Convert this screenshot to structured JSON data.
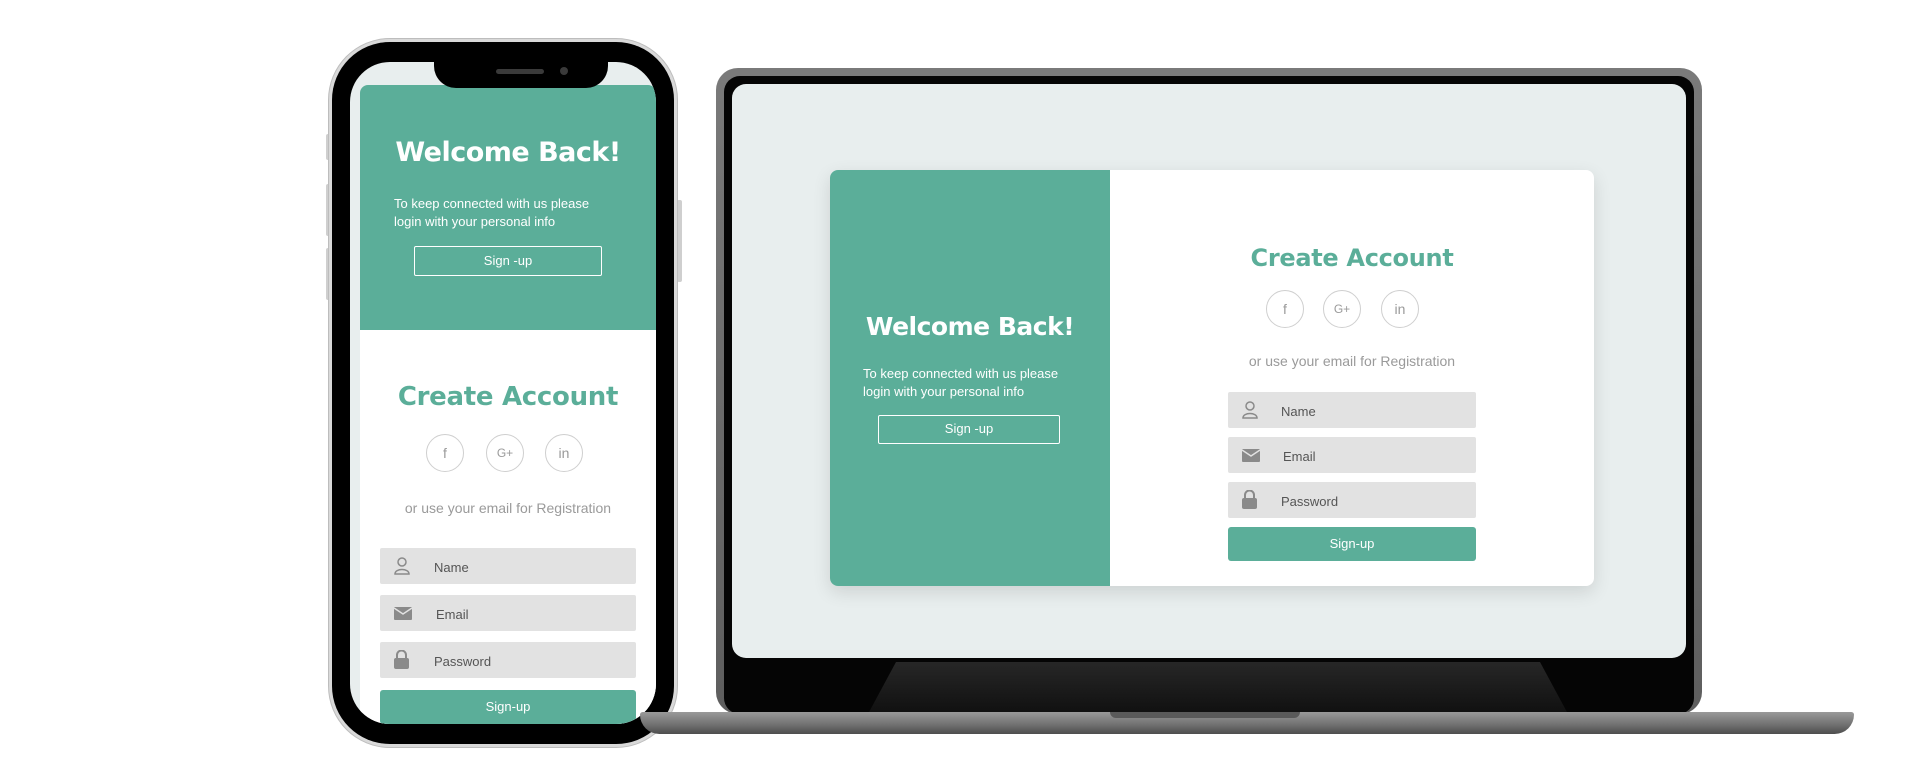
{
  "colors": {
    "accent": "#5bae99",
    "screen_bg": "#e8eeee",
    "field_bg": "#e2e2e2"
  },
  "welcome": {
    "title": "Welcome Back!",
    "subtitle_line1": "To keep connected with us please",
    "subtitle_line2": "login with your personal info",
    "button_label": "Sign -up"
  },
  "register": {
    "title": "Create Account",
    "social": [
      {
        "icon": "facebook-icon",
        "label": "f"
      },
      {
        "icon": "google-plus-icon",
        "label": "G+"
      },
      {
        "icon": "linkedin-icon",
        "label": "in"
      }
    ],
    "or_text": "or use your email for Registration",
    "fields": {
      "name_placeholder": "Name",
      "email_placeholder": "Email",
      "password_placeholder": "Password"
    },
    "submit_label": "Sign-up"
  }
}
